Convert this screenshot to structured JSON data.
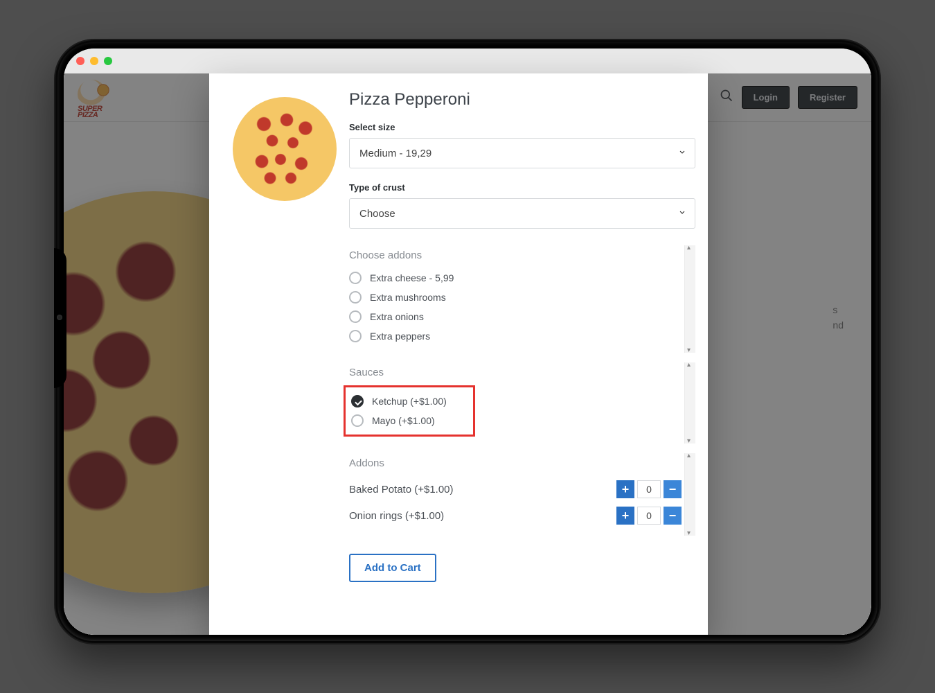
{
  "logo_text": "SUPER\nPIZZA",
  "nav": {
    "login": "Login",
    "register": "Register"
  },
  "bg_text_1": "s",
  "bg_text_2": "nd",
  "modal": {
    "title": "Pizza Pepperoni",
    "size": {
      "label": "Select size",
      "value": "Medium - 19,29"
    },
    "crust": {
      "label": "Type of crust",
      "value": "Choose"
    },
    "addons_sec": {
      "title": "Choose addons",
      "items": [
        "Extra cheese - 5,99",
        "Extra mushrooms",
        "Extra onions",
        "Extra peppers"
      ]
    },
    "sauces": {
      "title": "Sauces",
      "items": [
        {
          "label": "Ketchup (+$1.00)",
          "checked": true
        },
        {
          "label": "Mayo (+$1.00)",
          "checked": false
        }
      ]
    },
    "addons2": {
      "title": "Addons",
      "rows": [
        {
          "label": "Baked Potato (+$1.00)",
          "qty": "0"
        },
        {
          "label": "Onion rings (+$1.00)",
          "qty": "0"
        }
      ]
    },
    "add_to_cart": "Add to Cart"
  }
}
